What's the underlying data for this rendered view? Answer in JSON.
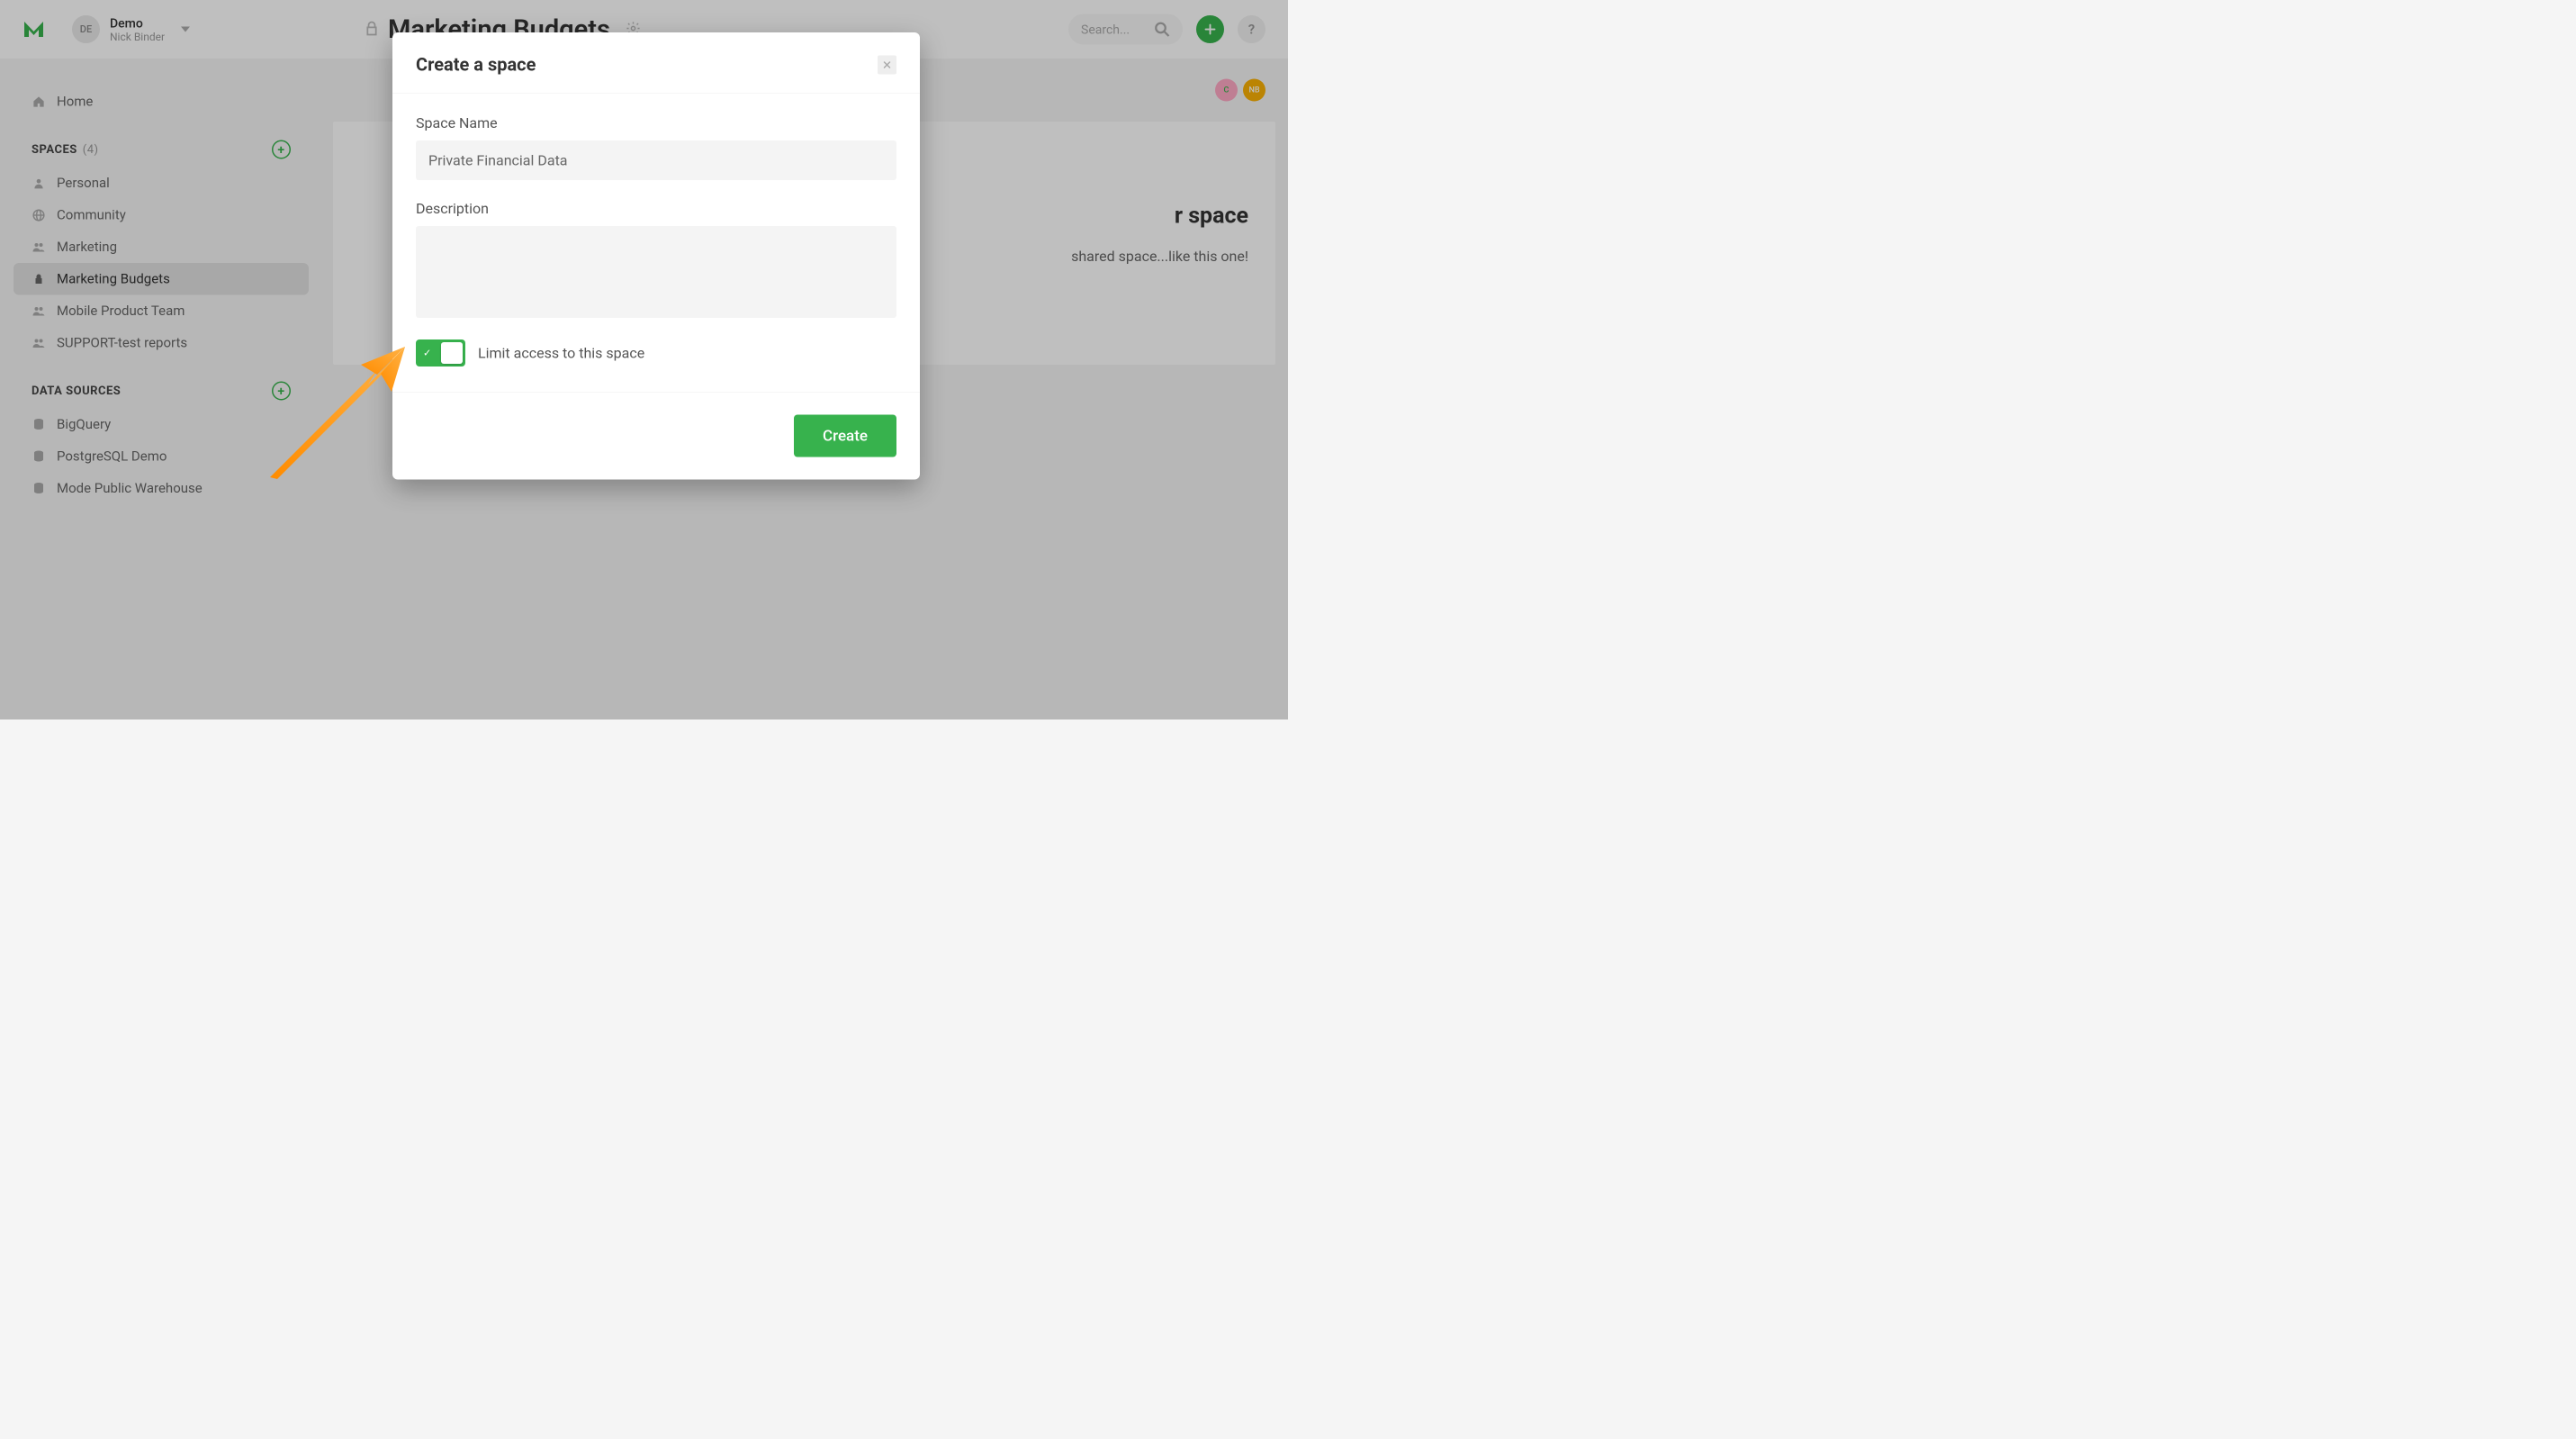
{
  "header": {
    "account_initials": "DE",
    "account_name": "Demo",
    "user_name": "Nick Binder",
    "page_title": "Marketing Budgets",
    "search_placeholder": "Search..."
  },
  "people": {
    "avatar_c": "C",
    "avatar_nb": "NB"
  },
  "sidebar": {
    "home_label": "Home",
    "spaces_header": "SPACES",
    "spaces_count": "(4)",
    "spaces": [
      {
        "label": "Personal",
        "icon": "person"
      },
      {
        "label": "Community",
        "icon": "globe"
      },
      {
        "label": "Marketing",
        "icon": "people"
      },
      {
        "label": "Marketing Budgets",
        "icon": "lock"
      },
      {
        "label": "Mobile Product Team",
        "icon": "people"
      },
      {
        "label": "SUPPORT-test reports",
        "icon": "people"
      }
    ],
    "data_sources_header": "DATA SOURCES",
    "data_sources": [
      {
        "label": "BigQuery"
      },
      {
        "label": "PostgreSQL Demo"
      },
      {
        "label": "Mode Public Warehouse"
      }
    ]
  },
  "empty_state": {
    "title_fragment": "r space",
    "hint_fragment": "shared space...like this one!"
  },
  "modal": {
    "title": "Create a space",
    "name_label": "Space Name",
    "name_value": "Private Financial Data",
    "description_label": "Description",
    "limit_access_label": "Limit access to this space",
    "create_button": "Create"
  }
}
